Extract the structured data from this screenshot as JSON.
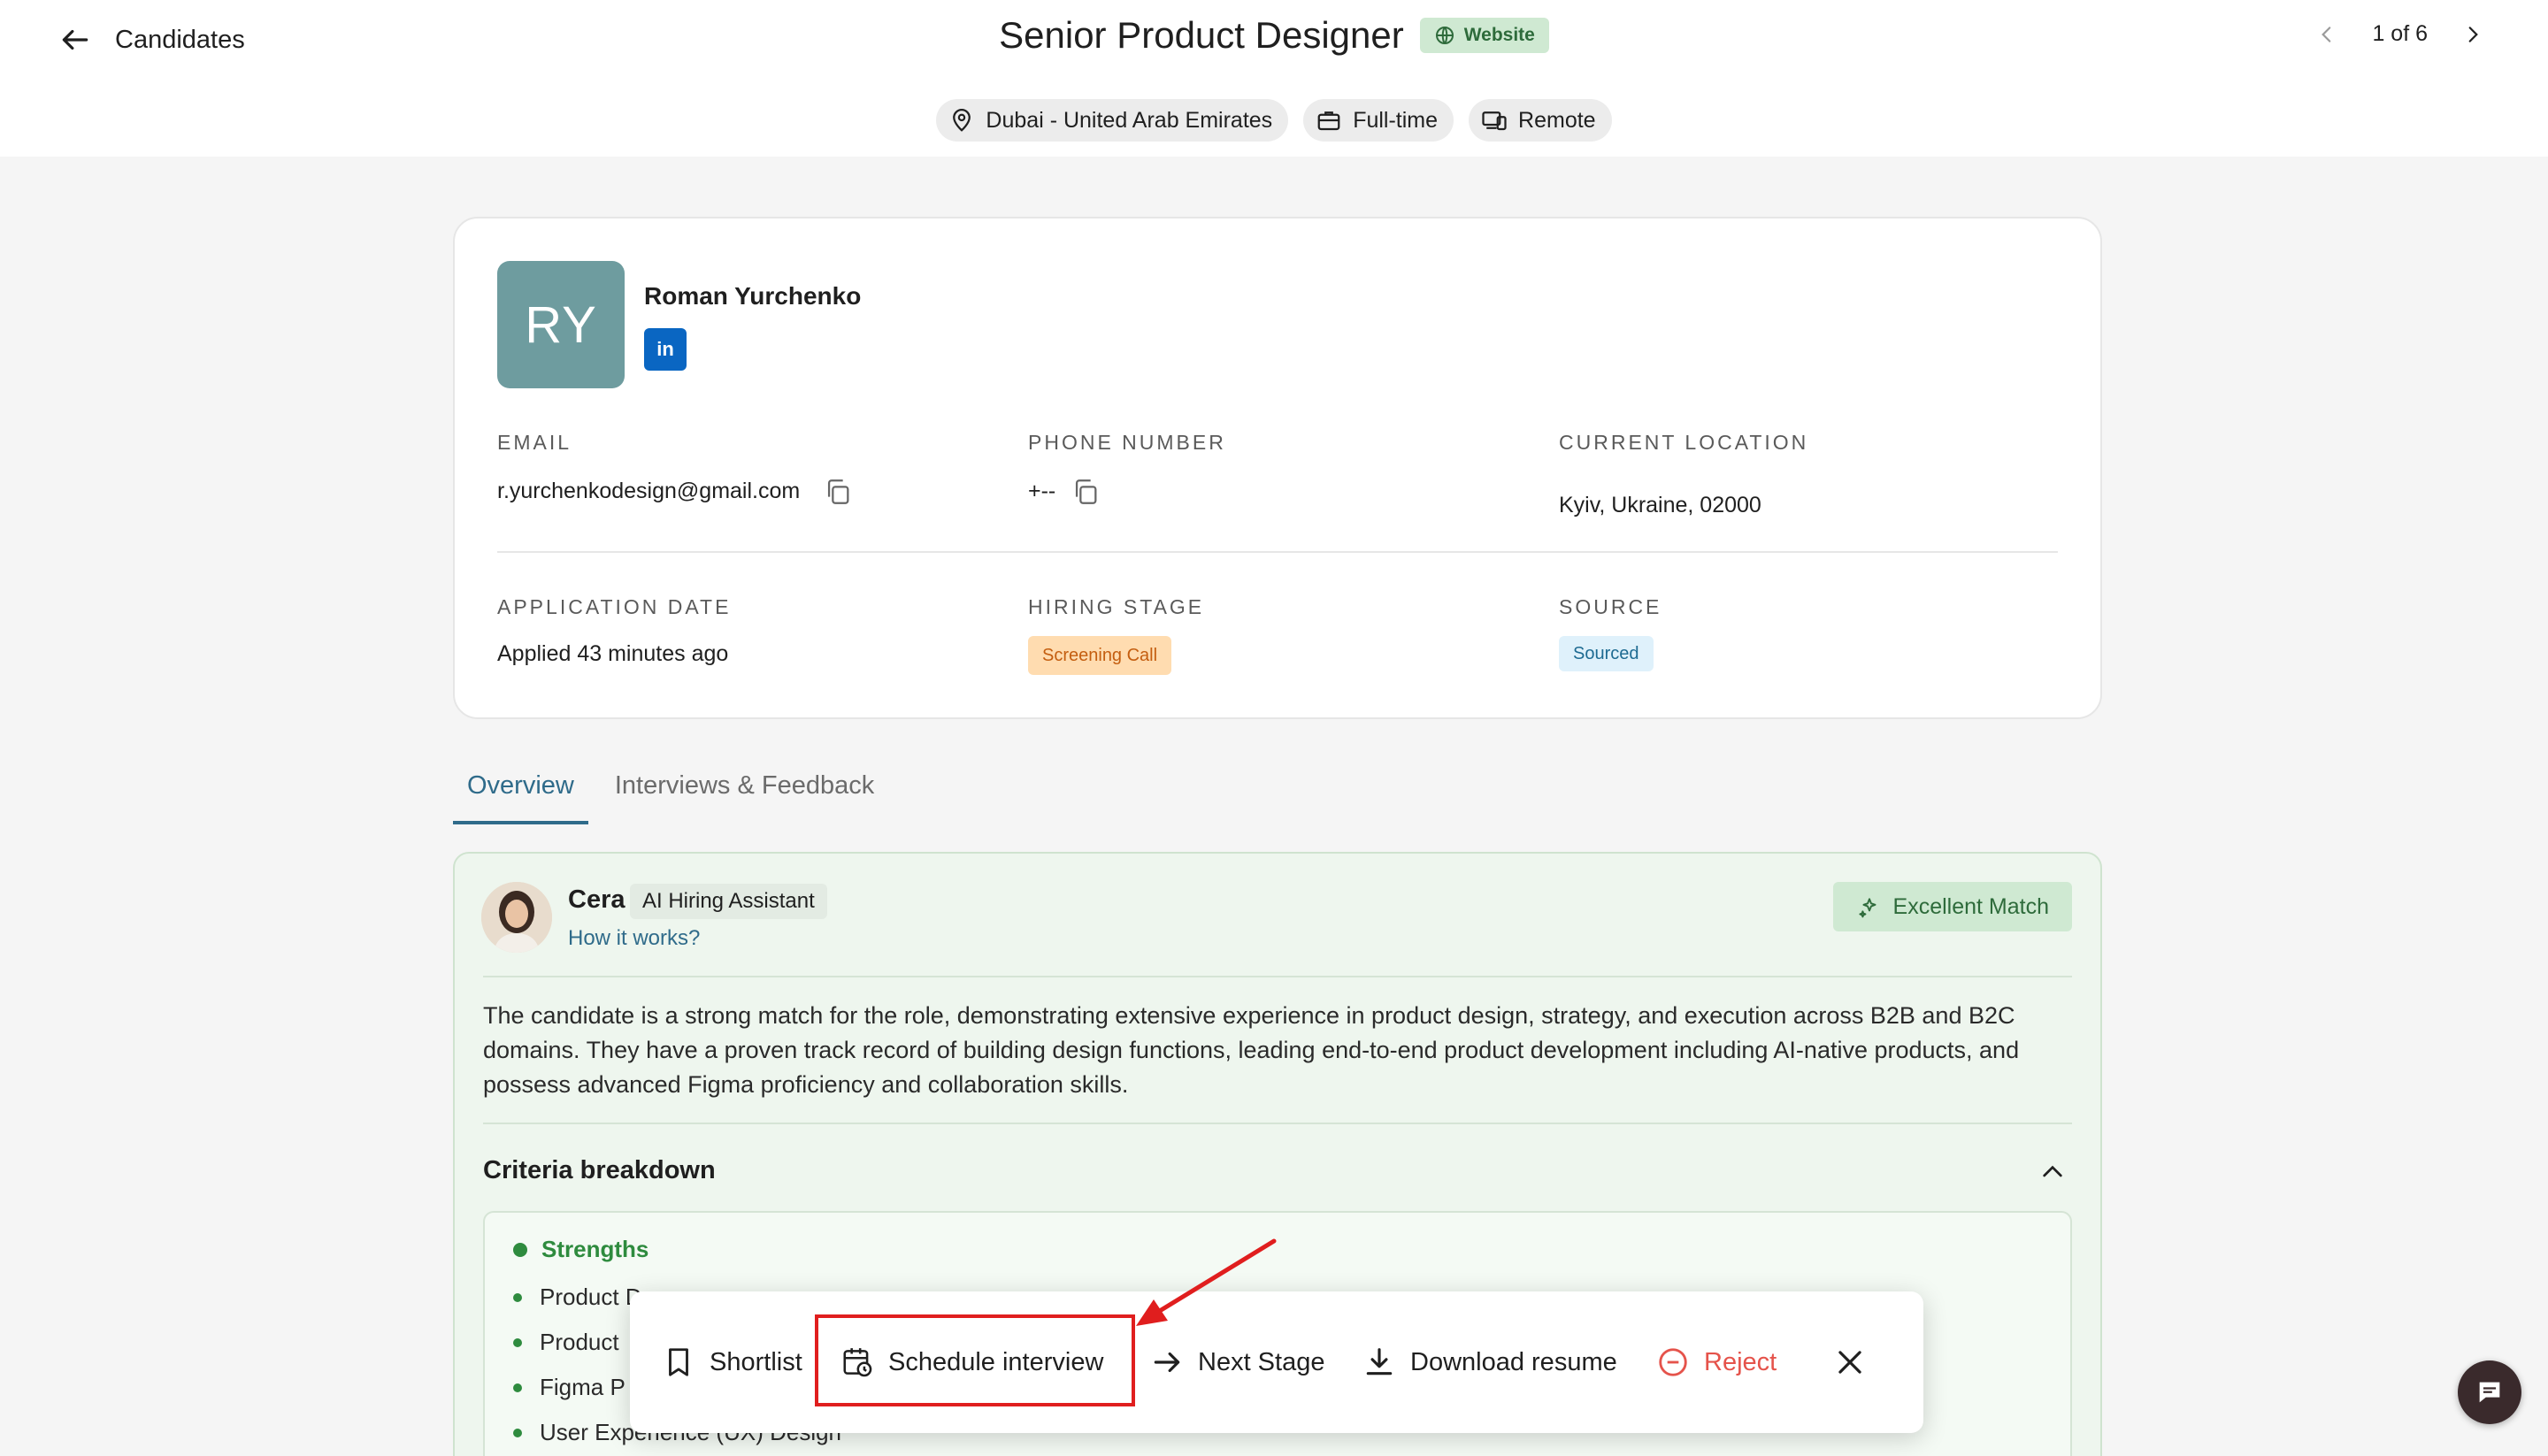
{
  "header": {
    "back_label": "Candidates",
    "job_title": "Senior Product Designer",
    "job_badge": "Website",
    "pager": "1 of 6",
    "meta": {
      "location": "Dubai - United Arab Emirates",
      "employment": "Full-time",
      "workplace": "Remote"
    }
  },
  "candidate": {
    "initials": "RY",
    "name": "Roman Yurchenko",
    "linkedin_label": "in",
    "fields": {
      "email_label": "EMAIL",
      "email": "r.yurchenkodesign@gmail.com",
      "phone_label": "PHONE NUMBER",
      "phone": "+--",
      "location_label": "CURRENT LOCATION",
      "location": "Kyiv, Ukraine, 02000",
      "app_date_label": "APPLICATION DATE",
      "app_date": "Applied 43 minutes ago",
      "stage_label": "HIRING STAGE",
      "stage": "Screening Call",
      "source_label": "SOURCE",
      "source": "Sourced"
    }
  },
  "tabs": [
    {
      "label": "Overview",
      "active": true
    },
    {
      "label": "Interviews & Feedback",
      "active": false
    }
  ],
  "assistant": {
    "name": "Cera",
    "role": "AI Hiring Assistant",
    "how_link": "How it works?",
    "match": "Excellent Match",
    "summary": "The candidate is a strong match for the role, demonstrating extensive experience in product design, strategy, and execution across B2B and B2C domains. They have a proven track record of building design functions, leading end-to-end product development including AI-native products, and possess advanced Figma proficiency and collaboration skills.",
    "criteria_title": "Criteria breakdown",
    "strengths_label": "Strengths",
    "strengths": [
      "Product D",
      "Product",
      "Figma P",
      "User Experience (UX) Design"
    ]
  },
  "action_bar": {
    "shortlist": "Shortlist",
    "schedule": "Schedule interview",
    "next_stage": "Next Stage",
    "download": "Download resume",
    "reject": "Reject"
  },
  "colors": {
    "accent": "#2f6b8a",
    "success": "#2e8b3e",
    "danger": "#e5534b",
    "highlight": "#e01e1e"
  }
}
